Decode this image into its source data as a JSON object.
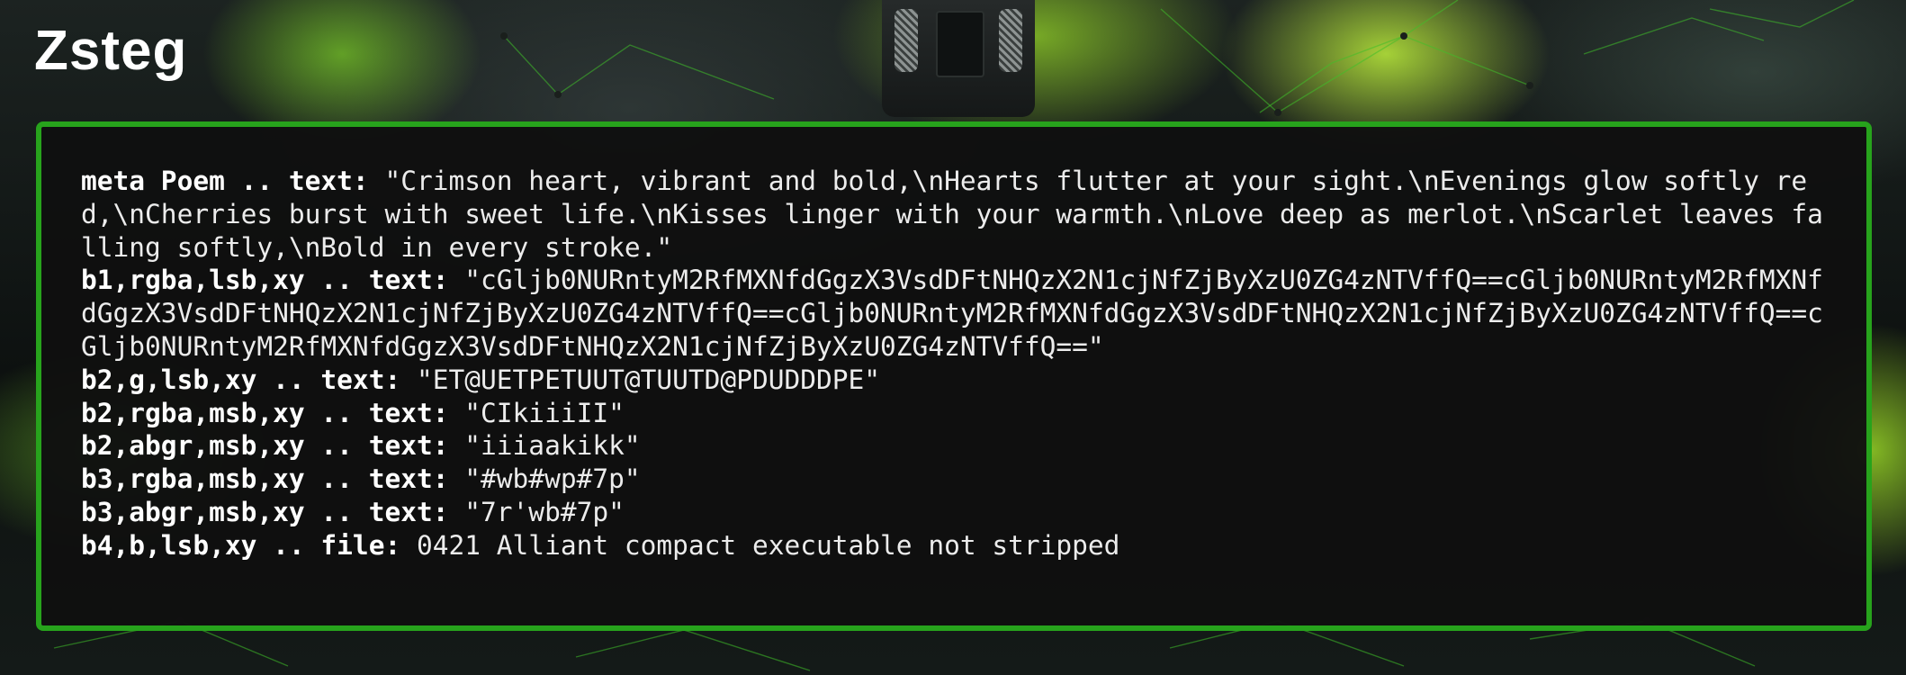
{
  "app": {
    "title": "Zsteg"
  },
  "output": {
    "lines": [
      {
        "key": "meta Poem .. text:",
        "value": " \"Crimson heart, vibrant and bold,\\nHearts flutter at your sight.\\nEvenings glow softly red,\\nCherries burst with sweet life.\\nKisses linger with your warmth.\\nLove deep as merlot.\\nScarlet leaves falling softly,\\nBold in every stroke.\""
      },
      {
        "key": "b1,rgba,lsb,xy .. text:",
        "value": " \"cGljb0NURntyM2RfMXNfdGgzX3VsdDFtNHQzX2N1cjNfZjByXzU0ZG4zNTVffQ==cGljb0NURntyM2RfMXNfdGgzX3VsdDFtNHQzX2N1cjNfZjByXzU0ZG4zNTVffQ==cGljb0NURntyM2RfMXNfdGgzX3VsdDFtNHQzX2N1cjNfZjByXzU0ZG4zNTVffQ==cGljb0NURntyM2RfMXNfdGgzX3VsdDFtNHQzX2N1cjNfZjByXzU0ZG4zNTVffQ==\""
      },
      {
        "key": "b2,g,lsb,xy .. text:",
        "value": " \"ET@UETPETUUT@TUUTD@PDUDDDPE\""
      },
      {
        "key": "b2,rgba,msb,xy .. text:",
        "value": " \"CIkiiiII\""
      },
      {
        "key": "b2,abgr,msb,xy .. text:",
        "value": " \"iiiaakikk\""
      },
      {
        "key": "b3,rgba,msb,xy .. text:",
        "value": " \"#wb#wp#7p\""
      },
      {
        "key": "b3,abgr,msb,xy .. text:",
        "value": " \"7r'wb#7p\""
      },
      {
        "key": "b4,b,lsb,xy .. file:",
        "value": " 0421 Alliant compact executable not stripped"
      }
    ]
  },
  "colors": {
    "accent": "#27a31c",
    "panel_bg": "#101010",
    "text": "#ececec"
  }
}
